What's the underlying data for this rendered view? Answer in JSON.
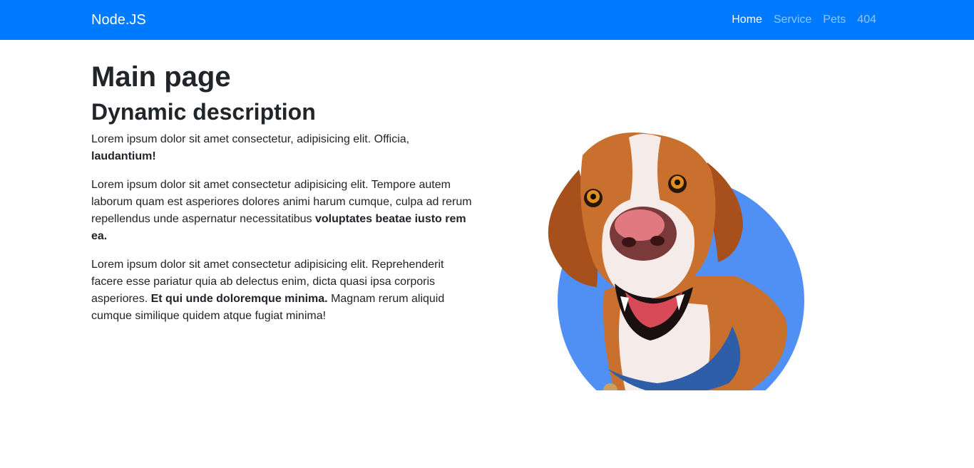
{
  "navbar": {
    "brand": "Node.JS",
    "links": [
      {
        "label": "Home",
        "active": true
      },
      {
        "label": "Service",
        "active": false
      },
      {
        "label": "Pets",
        "active": false
      },
      {
        "label": "404",
        "active": false
      }
    ]
  },
  "main": {
    "title": "Main page",
    "subtitle": "Dynamic description",
    "paragraphs": [
      {
        "text": "Lorem ipsum dolor sit amet consectetur, adipisicing elit. Officia,",
        "bold": "laudantium!",
        "after": ""
      },
      {
        "text": "Lorem ipsum dolor sit amet consectetur adipisicing elit. Tempore autem laborum quam est asperiores dolores animi harum cumque, culpa ad rerum repellendus unde aspernatur necessitatibus",
        "bold": "voluptates beatae iusto rem ea.",
        "after": ""
      },
      {
        "text": "Lorem ipsum dolor sit amet consectetur adipisicing elit. Reprehenderit facere esse pariatur quia ab delectus enim, dicta quasi ipsa corporis asperiores.",
        "bold": "Et qui unde doloremque minima.",
        "after": "Magnam rerum aliquid cumque similique quidem atque fugiat minima!"
      }
    ]
  },
  "hero": {
    "image": "dog-illustration",
    "circle_color": "#5090f5"
  },
  "colors": {
    "navbar_bg": "#007bff",
    "text": "#212529"
  }
}
